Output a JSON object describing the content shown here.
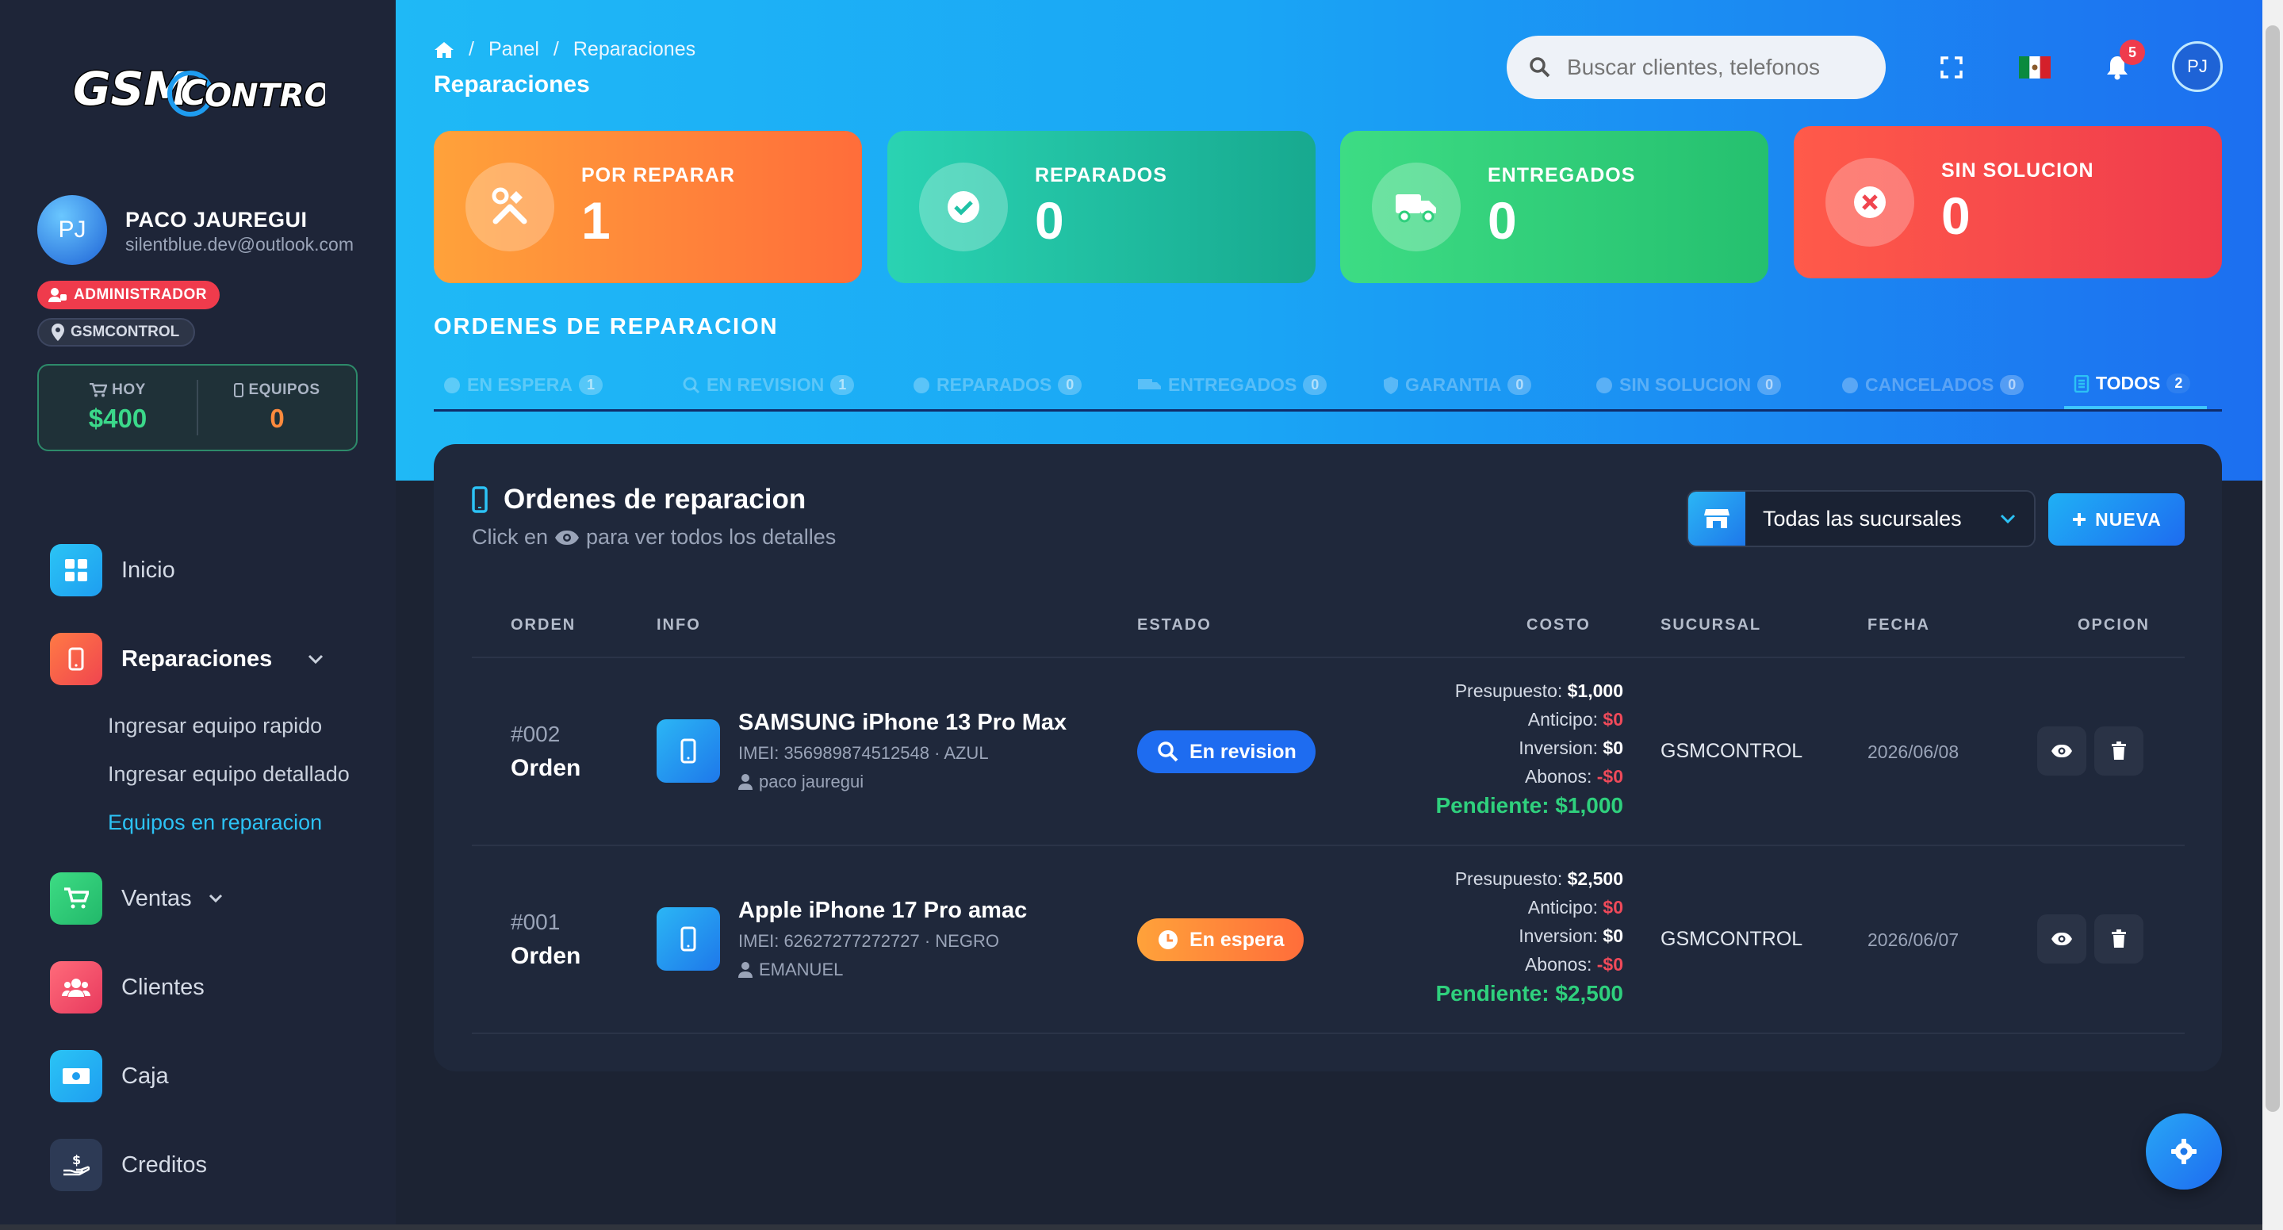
{
  "brand": {
    "logo_text_1": "GSM",
    "logo_text_2": "CONTROL"
  },
  "profile": {
    "initials": "PJ",
    "name": "PACO JAUREGUI",
    "email": "silentblue.dev@outlook.com",
    "role": "ADMINISTRADOR",
    "branch": "GSMCONTROL",
    "today_label": "HOY",
    "today_value": "$400",
    "devices_label": "EQUIPOS",
    "devices_value": "0"
  },
  "nav": {
    "inicio": "Inicio",
    "reparaciones": "Reparaciones",
    "sub_rapido": "Ingresar equipo rapido",
    "sub_detallado": "Ingresar equipo detallado",
    "sub_en_reparacion": "Equipos en reparacion",
    "ventas": "Ventas",
    "clientes": "Clientes",
    "caja": "Caja",
    "creditos": "Creditos"
  },
  "header": {
    "crumb_panel": "Panel",
    "crumb_current": "Reparaciones",
    "title": "Reparaciones",
    "search_placeholder": "Buscar clientes, telefonos",
    "notifications": "5",
    "avatar": "PJ"
  },
  "cards": [
    {
      "label": "POR REPARAR",
      "value": "1",
      "icon": "tools-icon"
    },
    {
      "label": "REPARADOS",
      "value": "0",
      "icon": "check-circle-icon"
    },
    {
      "label": "ENTREGADOS",
      "value": "0",
      "icon": "truck-icon"
    },
    {
      "label": "SIN SOLUCION",
      "value": "0",
      "icon": "x-circle-icon"
    }
  ],
  "section_title": "ORDENES DE REPARACION",
  "tabs": [
    {
      "label": "EN ESPERA",
      "count": "1"
    },
    {
      "label": "EN REVISION",
      "count": "1"
    },
    {
      "label": "REPARADOS",
      "count": "0"
    },
    {
      "label": "ENTREGADOS",
      "count": "0"
    },
    {
      "label": "GARANTIA",
      "count": "0"
    },
    {
      "label": "SIN SOLUCION",
      "count": "0"
    },
    {
      "label": "CANCELADOS",
      "count": "0"
    },
    {
      "label": "TODOS",
      "count": "2"
    }
  ],
  "panel": {
    "title": "Ordenes de reparacion",
    "subtitle_pre": "Click en",
    "subtitle_post": "para ver todos los detalles",
    "branch_select": "Todas las sucursales",
    "new_button": "NUEVA"
  },
  "table": {
    "headers": {
      "orden": "ORDEN",
      "info": "INFO",
      "estado": "ESTADO",
      "costo": "COSTO",
      "sucursal": "SUCURSAL",
      "fecha": "FECHA",
      "opcion": "OPCION"
    },
    "rows": [
      {
        "num": "#002",
        "label": "Orden",
        "device": "SAMSUNG iPhone 13 Pro Max",
        "imei": "IMEI: 356989874512548 · AZUL",
        "owner": "paco jauregui",
        "status": "En revision",
        "presupuesto_label": "Presupuesto:",
        "presupuesto": "$1,000",
        "anticipo_label": "Anticipo:",
        "anticipo": "$0",
        "inversion_label": "Inversion:",
        "inversion": "$0",
        "abonos_label": "Abonos:",
        "abonos": "-$0",
        "pendiente": "Pendiente: $1,000",
        "sucursal": "GSMCONTROL",
        "fecha": "2026/06/08"
      },
      {
        "num": "#001",
        "label": "Orden",
        "device": "Apple iPhone 17 Pro amac",
        "imei": "IMEI: 62627277272727 · NEGRO",
        "owner": "EMANUEL",
        "status": "En espera",
        "presupuesto_label": "Presupuesto:",
        "presupuesto": "$2,500",
        "anticipo_label": "Anticipo:",
        "anticipo": "$0",
        "inversion_label": "Inversion:",
        "inversion": "$0",
        "abonos_label": "Abonos:",
        "abonos": "-$0",
        "pendiente": "Pendiente: $2,500",
        "sucursal": "GSMCONTROL",
        "fecha": "2026/06/07"
      }
    ]
  },
  "colors": {
    "accent": "#1e78ea",
    "card_orange": "#ff8a3d",
    "card_teal": "#1fc2a6",
    "card_green": "#2fcf7d",
    "card_red": "#f0454f",
    "pending_green": "#2fd07d"
  }
}
